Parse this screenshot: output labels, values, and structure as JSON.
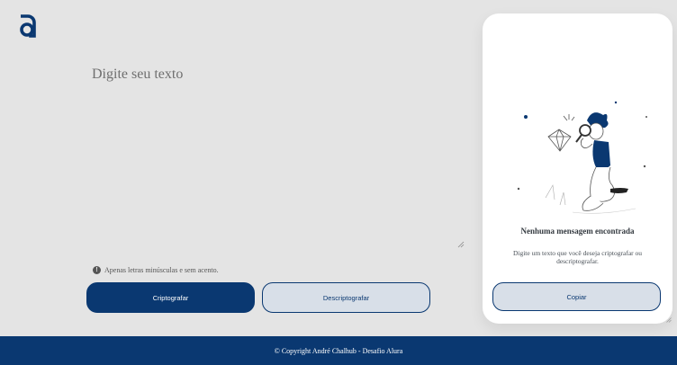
{
  "colors": {
    "primary": "#0a3871",
    "background": "#e4e4e4",
    "button_secondary_bg": "#d8dfe8",
    "panel_bg": "#ffffff"
  },
  "logo": {
    "icon": "alura-a-logo-icon"
  },
  "input": {
    "placeholder": "Digite seu texto",
    "value": ""
  },
  "hint": {
    "icon": "info-icon",
    "text": "Apenas letras minúsculas e sem acento."
  },
  "actions": {
    "encrypt_label": "Criptografar",
    "decrypt_label": "Descriptografar"
  },
  "output": {
    "illustration": "person-with-magnifying-glass-illustration",
    "empty_title": "Nenhuma mensagem encontrada",
    "empty_description": "Digite um texto que você deseja criptografar ou descriptografar.",
    "copy_label": "Copiar"
  },
  "footer": {
    "text": "© Copyright André Chalhub - Desafio Alura"
  }
}
